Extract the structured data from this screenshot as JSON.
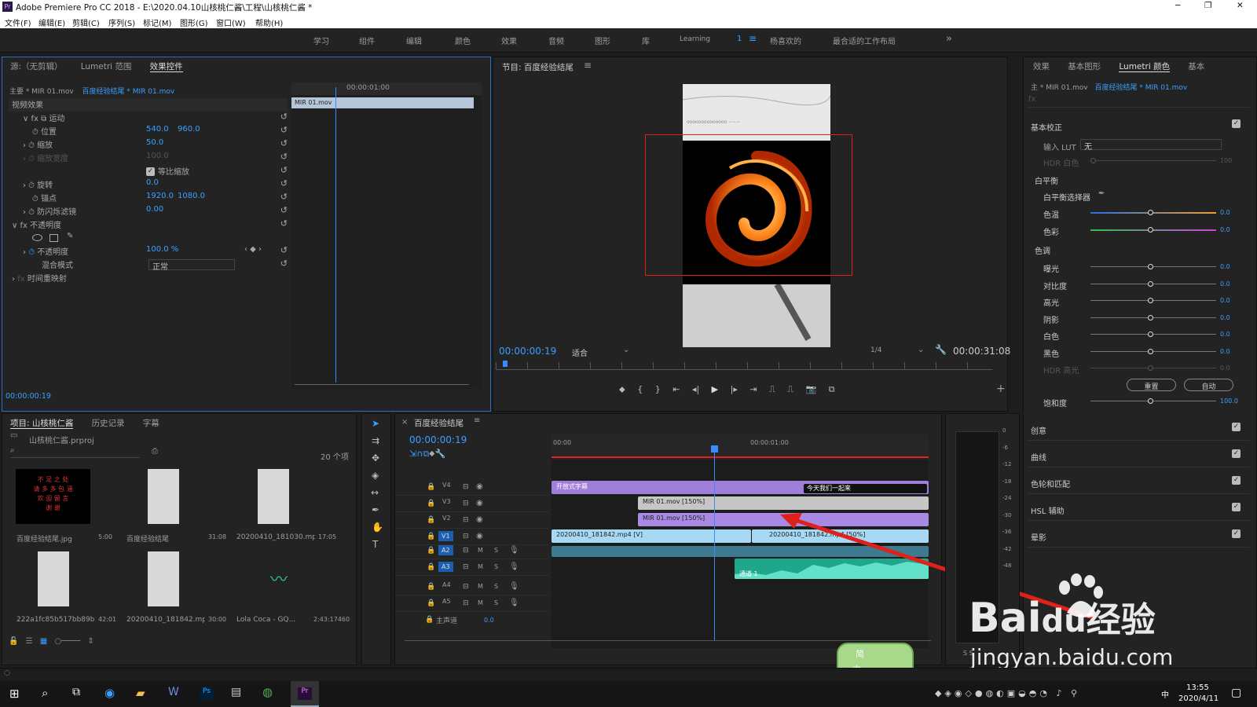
{
  "app": {
    "title": "Adobe Premiere Pro CC 2018 - E:\\2020.04.10山核桃仁酱\\工程\\山核桃仁酱 *",
    "win_min": "─",
    "win_max": "❐",
    "win_close": "✕"
  },
  "menu": [
    "文件(F)",
    "编辑(E)",
    "剪辑(C)",
    "序列(S)",
    "标记(M)",
    "图形(G)",
    "窗口(W)",
    "帮助(H)"
  ],
  "workspaces": [
    "学习",
    "组件",
    "编辑",
    "颜色",
    "效果",
    "音频",
    "图形",
    "库",
    "Learning",
    "1",
    "杨喜欢的",
    "最合适的工作布局"
  ],
  "ws_more": "»",
  "effect_controls": {
    "tabs": [
      "源:（无剪辑）",
      "Lumetri 范围",
      "效果控件"
    ],
    "master": "主要 * MIR 01.mov",
    "clip": "百度经验结尾 * MIR 01.mov",
    "ruler_time": "00:00:01:00",
    "clip_bar": "MIR 01.mov",
    "section": "视频效果",
    "rows": [
      {
        "label": "运动",
        "v1": "",
        "v2": ""
      },
      {
        "label": "位置",
        "v1": "540.0",
        "v2": "960.0"
      },
      {
        "label": "缩放",
        "v1": "50.0",
        "v2": ""
      },
      {
        "label": "缩放宽度",
        "v1": "100.0",
        "v2": ""
      },
      {
        "label": "等比缩放",
        "v1": "",
        "v2": ""
      },
      {
        "label": "旋转",
        "v1": "0.0",
        "v2": ""
      },
      {
        "label": "锚点",
        "v1": "1920.0",
        "v2": "1080.0"
      },
      {
        "label": "防闪烁滤镜",
        "v1": "0.00",
        "v2": ""
      },
      {
        "label": "不透明度",
        "v1": "",
        "v2": ""
      },
      {
        "label": "",
        "v1": "",
        "v2": ""
      },
      {
        "label": "不透明度",
        "v1": "100.0 %",
        "v2": ""
      },
      {
        "label": "混合模式",
        "v1": "正常",
        "v2": ""
      },
      {
        "label": "时间重映射",
        "v1": "",
        "v2": ""
      }
    ],
    "timecode": "00:00:00:19"
  },
  "program": {
    "title": "节目: 百度经验结尾",
    "timecode": "00:00:00:19",
    "fit": "适合",
    "res": "1/4",
    "duration": "00:00:31:08"
  },
  "project": {
    "tabs": [
      "项目: 山核桃仁酱",
      "历史记录",
      "字幕"
    ],
    "file": "山核桃仁酱.prproj",
    "count": "20 个项",
    "items": [
      {
        "name": "百度经验结尾.jpg",
        "dur": "5:00",
        "thumb_text": "不 足 之 处\n请 多 多 包 涵\n欢 迎 留 言\n谢 谢"
      },
      {
        "name": "百度经验结尾",
        "dur": "31:08",
        "thumb_text": ""
      },
      {
        "name": "20200410_181030.mp4",
        "dur": "17:05",
        "thumb_text": ""
      },
      {
        "name": "222a1fc85b517bb89b5...",
        "dur": "42:01",
        "thumb_text": ""
      },
      {
        "name": "20200410_181842.mp4",
        "dur": "30:00",
        "thumb_text": ""
      },
      {
        "name": "Lola Coca - GQ...",
        "dur": "2:43:17460",
        "thumb_text": ""
      }
    ]
  },
  "timeline": {
    "title": "百度经验结尾",
    "timecode": "00:00:00:19",
    "ruler": [
      "00:00",
      "00:00:01:00"
    ],
    "tracks": [
      "V4",
      "V3",
      "V2",
      "V1",
      "A2",
      "A3",
      "A4",
      "A5"
    ],
    "master": "主声道",
    "master_val": "0.0",
    "clips": {
      "v4a": "开放式字幕",
      "v4b": "今天我们一起来",
      "v3": "MIR 01.mov [150%]",
      "v2": "MIR 01.mov [150%]",
      "v1a": "20200410_181842.mp4 [V]",
      "v1b": "20200410_181842.mp4 [50%]",
      "a3": "通道 1"
    }
  },
  "meter_labels": [
    "0",
    "-6",
    "-12",
    "-18",
    "-24",
    "-30",
    "-36",
    "-42",
    "-48"
  ],
  "meter_ss": "S S",
  "lumetri": {
    "tabs": [
      "效果",
      "基本图形",
      "Lumetri 颜色",
      "基本"
    ],
    "master": "主 * MIR 01.mov",
    "clip": "百度经验结尾 * MIR 01.mov",
    "basic": "基本校正",
    "lut_label": "输入 LUT",
    "lut_val": "无",
    "hdr_white": "HDR 白色",
    "hdr_val": "100",
    "wb": "白平衡",
    "wb_picker": "白平衡选择器",
    "sliders1": [
      {
        "label": "色温",
        "val": "0.0"
      },
      {
        "label": "色彩",
        "val": "0.0"
      }
    ],
    "tone": "色调",
    "sliders2": [
      {
        "label": "曝光",
        "val": "0.0"
      },
      {
        "label": "对比度",
        "val": "0.0"
      },
      {
        "label": "高光",
        "val": "0.0"
      },
      {
        "label": "阴影",
        "val": "0.0"
      },
      {
        "label": "白色",
        "val": "0.0"
      },
      {
        "label": "黑色",
        "val": "0.0"
      },
      {
        "label": "HDR 高光",
        "val": "0.0"
      }
    ],
    "reset": "重置",
    "auto": "自动",
    "saturation": "饱和度",
    "sat_val": "100.0",
    "sections": [
      "创意",
      "曲线",
      "色轮和匹配",
      "HSL 辅助",
      "晕影"
    ]
  },
  "watermark": {
    "brand": "Bai",
    "brand2": "du",
    "brand3": "经验",
    "url": "jingyan.baidu.com",
    "ime1": "简",
    "ime2": "中"
  },
  "taskbar": {
    "time": "13:55",
    "date": "2020/4/11",
    "ime": "中"
  }
}
